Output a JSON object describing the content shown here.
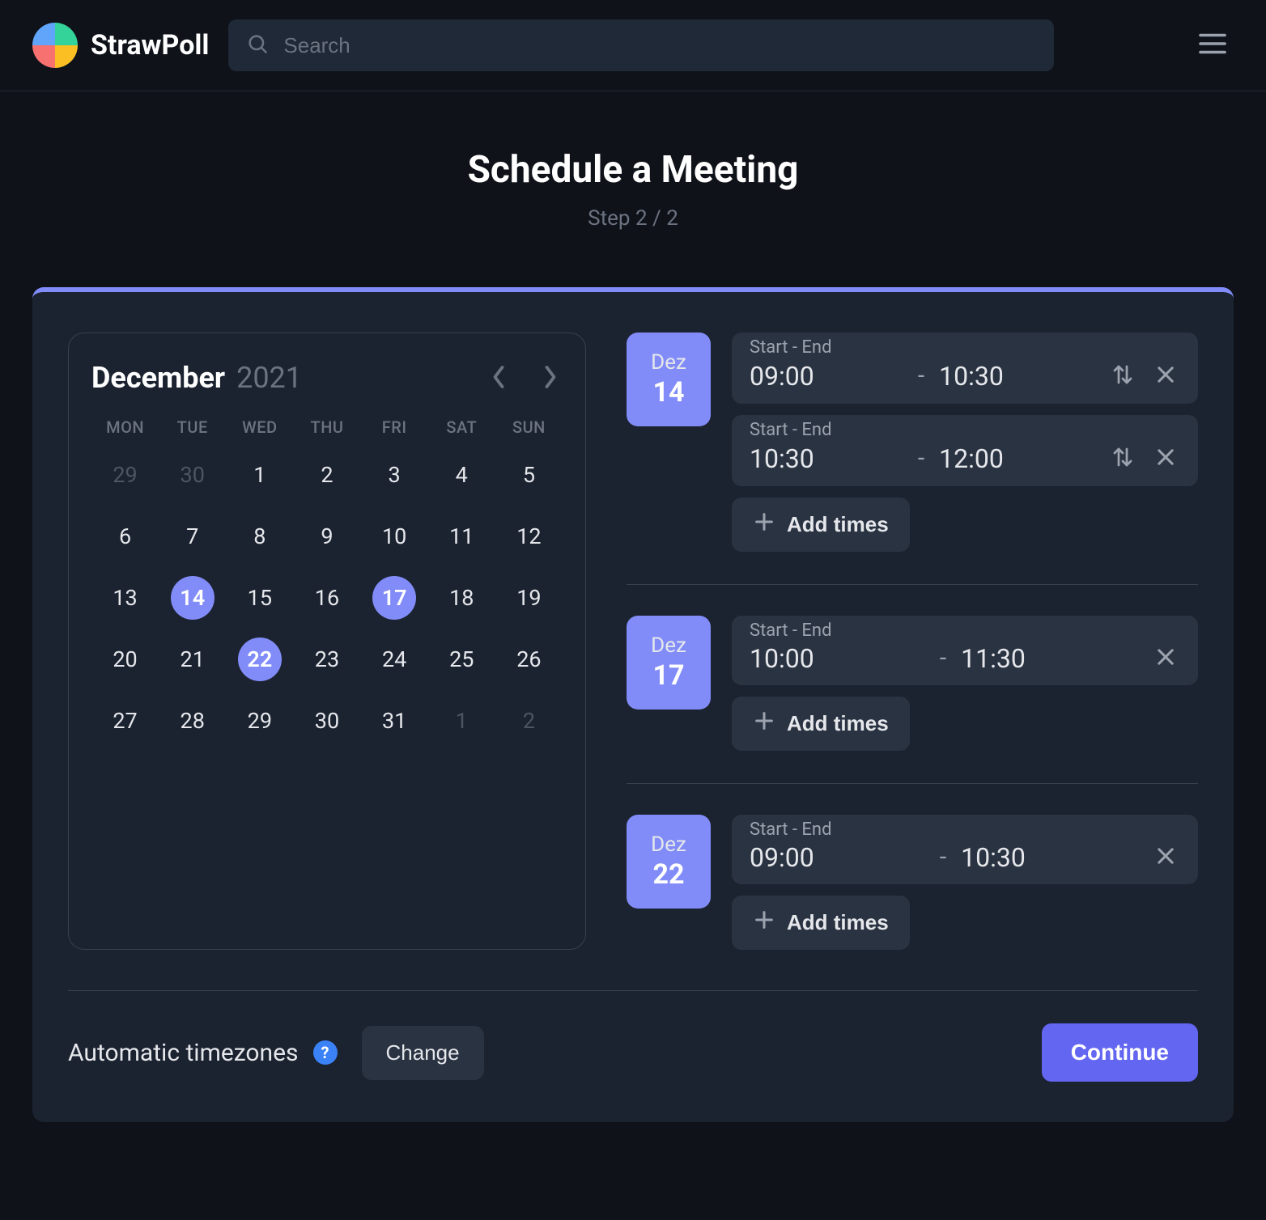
{
  "brand": "StrawPoll",
  "search": {
    "placeholder": "Search"
  },
  "page": {
    "title": "Schedule a Meeting",
    "step": "Step 2 / 2"
  },
  "calendar": {
    "month": "December",
    "year": "2021",
    "dows": [
      "MON",
      "TUE",
      "WED",
      "THU",
      "FRI",
      "SAT",
      "SUN"
    ],
    "cells": [
      {
        "d": "29",
        "muted": true
      },
      {
        "d": "30",
        "muted": true
      },
      {
        "d": "1"
      },
      {
        "d": "2"
      },
      {
        "d": "3"
      },
      {
        "d": "4"
      },
      {
        "d": "5"
      },
      {
        "d": "6"
      },
      {
        "d": "7"
      },
      {
        "d": "8"
      },
      {
        "d": "9"
      },
      {
        "d": "10"
      },
      {
        "d": "11"
      },
      {
        "d": "12"
      },
      {
        "d": "13"
      },
      {
        "d": "14",
        "selected": true
      },
      {
        "d": "15"
      },
      {
        "d": "16"
      },
      {
        "d": "17",
        "selected": true
      },
      {
        "d": "18"
      },
      {
        "d": "19"
      },
      {
        "d": "20"
      },
      {
        "d": "21"
      },
      {
        "d": "22",
        "selected": true
      },
      {
        "d": "23"
      },
      {
        "d": "24"
      },
      {
        "d": "25"
      },
      {
        "d": "26"
      },
      {
        "d": "27"
      },
      {
        "d": "28"
      },
      {
        "d": "29"
      },
      {
        "d": "30"
      },
      {
        "d": "31"
      },
      {
        "d": "1",
        "muted": true
      },
      {
        "d": "2",
        "muted": true
      }
    ]
  },
  "labels": {
    "start_end": "Start - End",
    "add_times": "Add times",
    "timezone": "Automatic timezones",
    "change": "Change",
    "continue": "Continue"
  },
  "dates": [
    {
      "month": "Dez",
      "day": "14",
      "slots": [
        {
          "start": "09:00",
          "end": "10:30",
          "sortable": true
        },
        {
          "start": "10:30",
          "end": "12:00",
          "sortable": true
        }
      ]
    },
    {
      "month": "Dez",
      "day": "17",
      "slots": [
        {
          "start": "10:00",
          "end": "11:30",
          "sortable": false
        }
      ]
    },
    {
      "month": "Dez",
      "day": "22",
      "slots": [
        {
          "start": "09:00",
          "end": "10:30",
          "sortable": false
        }
      ]
    }
  ]
}
